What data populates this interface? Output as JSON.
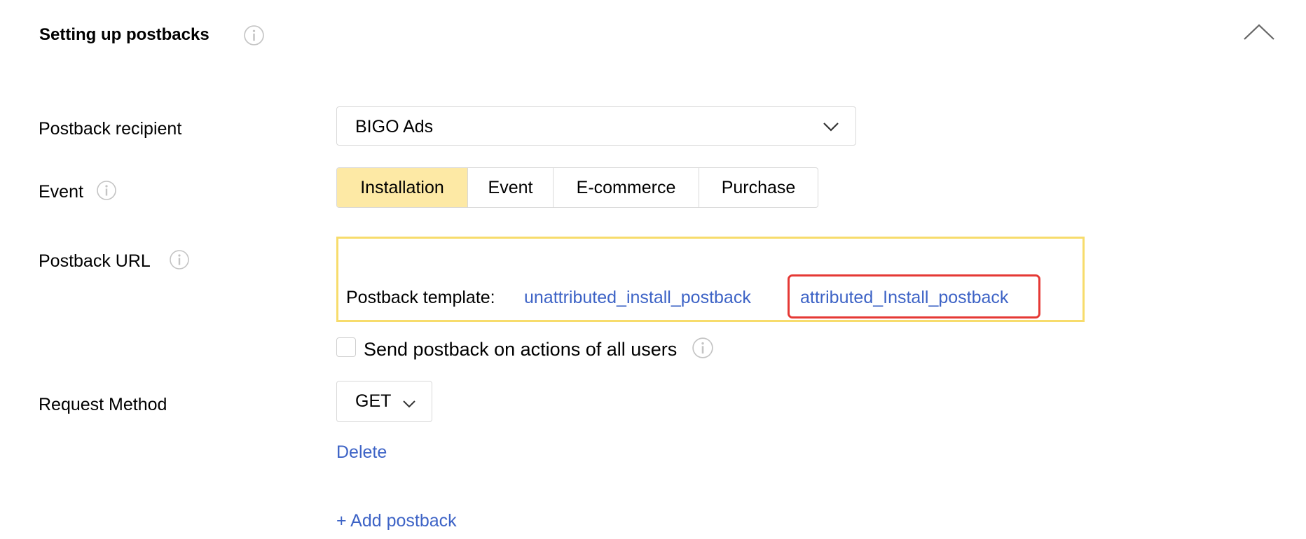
{
  "section": {
    "title": "Setting up postbacks"
  },
  "form": {
    "recipient": {
      "label": "Postback recipient",
      "value": "BIGO Ads"
    },
    "event": {
      "label": "Event",
      "options": [
        "Installation",
        "Event",
        "E-commerce",
        "Purchase"
      ],
      "selected": "Installation"
    },
    "postback_url": {
      "label": "Postback URL",
      "template_label": "Postback template:",
      "templates": [
        "unattributed_install_postback",
        "attributed_Install_postback"
      ],
      "highlighted_template": "attributed_Install_postback"
    },
    "send_all_users": {
      "label": "Send postback on actions of all users",
      "checked": false
    },
    "request_method": {
      "label": "Request Method",
      "value": "GET"
    },
    "delete_label": "Delete",
    "add_postback_label": "+ Add postback"
  },
  "icons": {
    "info": "info-icon",
    "collapse": "chevron-up-icon",
    "dropdown": "chevron-down-icon"
  },
  "colors": {
    "link": "#3d63c6",
    "active_segment": "#fde9a5",
    "field_highlight_border": "#f7dc6c",
    "annotation_frame": "#e53935",
    "icon_gray": "#c4c4c4"
  }
}
